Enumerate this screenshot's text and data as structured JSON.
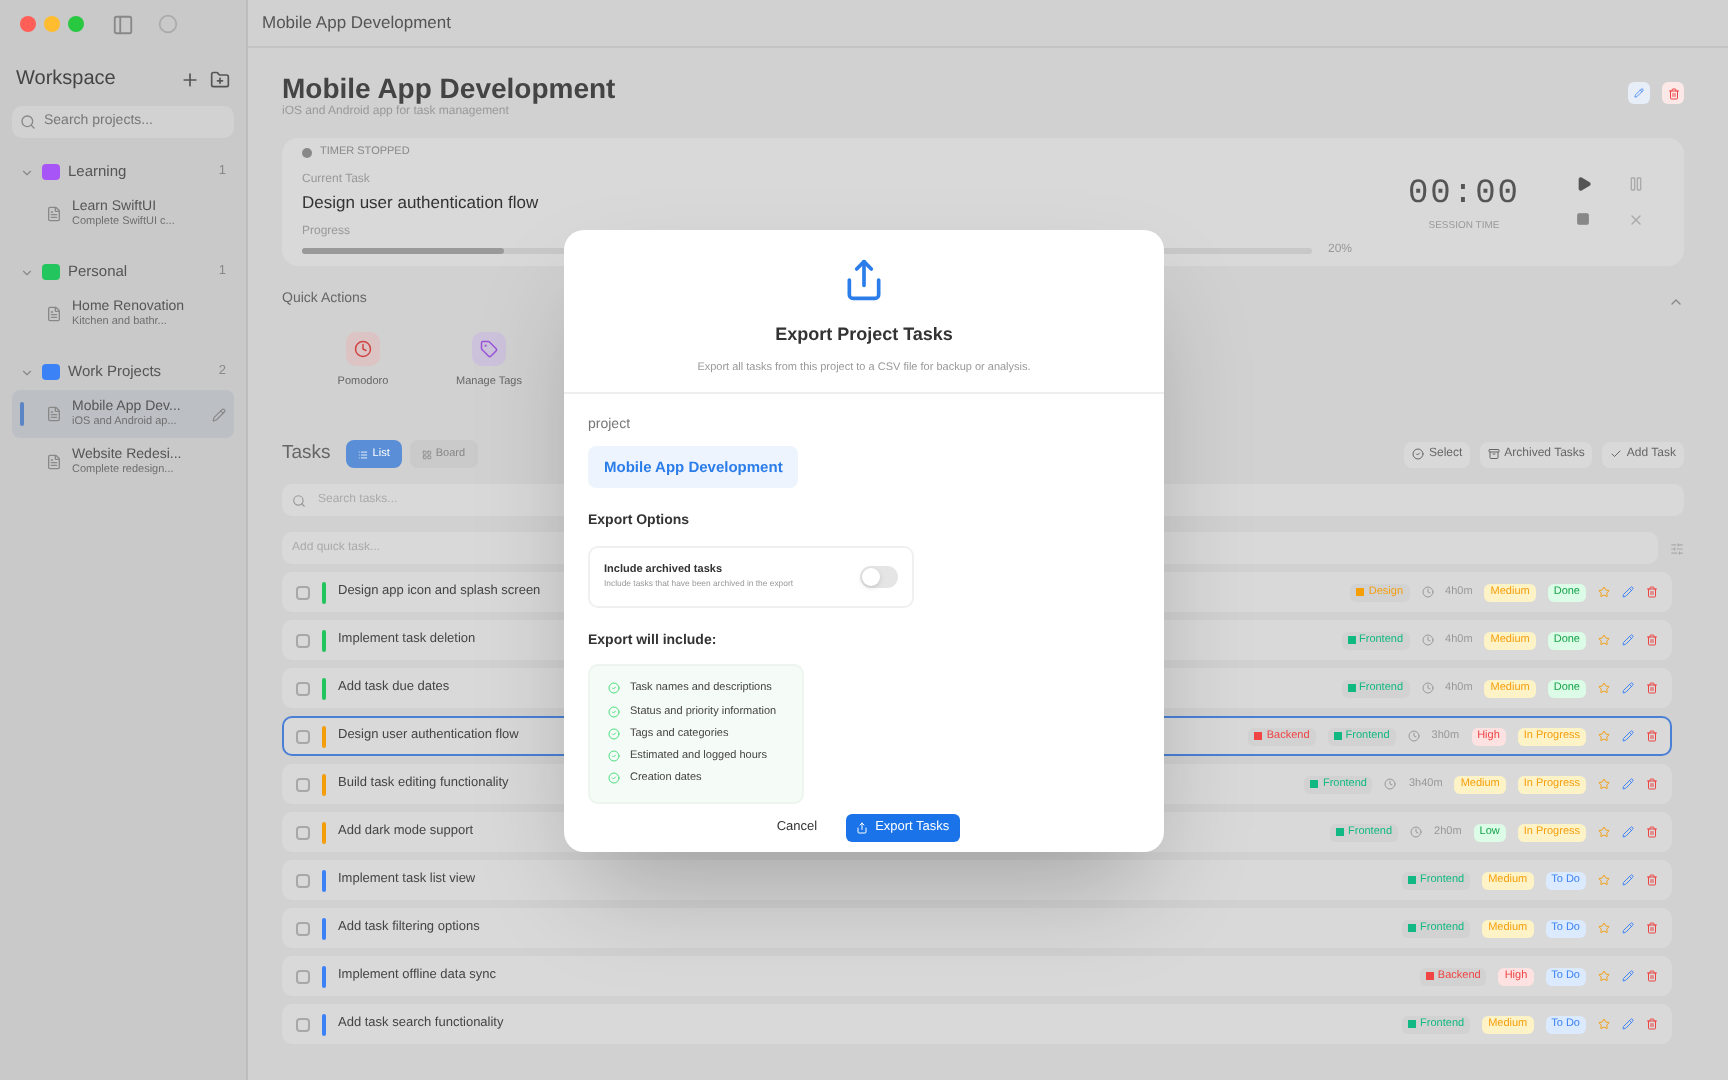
{
  "window": {
    "title": "Mobile App Development"
  },
  "sidebar": {
    "title": "Workspace",
    "search": {
      "placeholder": "Search projects..."
    },
    "groups": [
      {
        "name": "Learning",
        "color": "#a855f7",
        "count": "1",
        "projects": [
          {
            "name": "Learn SwiftUI",
            "description": "Complete SwiftUI c...",
            "selected": false
          }
        ]
      },
      {
        "name": "Personal",
        "color": "#22c55e",
        "count": "1",
        "projects": [
          {
            "name": "Home Renovation",
            "description": "Kitchen and bathr...",
            "selected": false
          }
        ]
      },
      {
        "name": "Work Projects",
        "color": "#3b82f6",
        "count": "2",
        "projects": [
          {
            "name": "Mobile App Dev...",
            "description": "iOS and Android ap...",
            "selected": true
          },
          {
            "name": "Website Redesi...",
            "description": "Complete redesign...",
            "selected": false
          }
        ]
      }
    ]
  },
  "project": {
    "title": "Mobile App Development",
    "subtitle": "iOS and Android app for task management"
  },
  "timer": {
    "status": "TIMER STOPPED",
    "current_label": "Current Task",
    "current_task": "Design user authentication flow",
    "progress_label": "Progress",
    "level": 0.2,
    "percent": "20%",
    "time": "00:00",
    "time_label": "SESSION TIME"
  },
  "quick_actions": {
    "title": "Quick Actions",
    "items": [
      {
        "kind": "pomodoro",
        "label": "Pomodoro"
      },
      {
        "kind": "tags",
        "label": "Manage Tags"
      }
    ]
  },
  "tasks": {
    "title": "Tasks",
    "views": [
      {
        "label": "List",
        "selected": true
      },
      {
        "label": "Board",
        "selected": false
      }
    ],
    "actions": [
      "Select",
      "Archived Tasks",
      "Add Task"
    ],
    "search": {
      "placeholder": "Search tasks..."
    },
    "quick_add": {
      "placeholder": "Add quick task..."
    },
    "rows": [
      {
        "title": "Design app icon and splash screen",
        "selected": false,
        "tags": [
          {
            "label": "Design",
            "color": "#f59e0b"
          }
        ],
        "time": "4h0m",
        "priority": {
          "kind": "medium",
          "label": "Medium"
        },
        "status": {
          "kind": "done",
          "label": "Done"
        }
      },
      {
        "title": "Implement task deletion",
        "selected": false,
        "tags": [
          {
            "label": "Frontend",
            "color": "#10b981"
          }
        ],
        "time": "4h0m",
        "priority": {
          "kind": "medium",
          "label": "Medium"
        },
        "status": {
          "kind": "done",
          "label": "Done"
        }
      },
      {
        "title": "Add task due dates",
        "selected": false,
        "tags": [
          {
            "label": "Frontend",
            "color": "#10b981"
          }
        ],
        "time": "4h0m",
        "priority": {
          "kind": "medium",
          "label": "Medium"
        },
        "status": {
          "kind": "done",
          "label": "Done"
        }
      },
      {
        "title": "Design user authentication flow",
        "selected": true,
        "tags": [
          {
            "label": "Backend",
            "color": "#ef4444"
          },
          {
            "label": "Frontend",
            "color": "#10b981"
          }
        ],
        "time": "3h0m",
        "priority": {
          "kind": "high",
          "label": "High"
        },
        "status": {
          "kind": "progress",
          "label": "In Progress"
        }
      },
      {
        "title": "Build task editing functionality",
        "selected": false,
        "tags": [
          {
            "label": "Frontend",
            "color": "#10b981"
          }
        ],
        "time": "3h40m",
        "priority": {
          "kind": "medium",
          "label": "Medium"
        },
        "status": {
          "kind": "progress",
          "label": "In Progress"
        }
      },
      {
        "title": "Add dark mode support",
        "selected": false,
        "tags": [
          {
            "label": "Frontend",
            "color": "#10b981"
          }
        ],
        "time": "2h0m",
        "priority": {
          "kind": "low",
          "label": "Low"
        },
        "status": {
          "kind": "progress",
          "label": "In Progress"
        }
      },
      {
        "title": "Implement task list view",
        "selected": false,
        "tags": [
          {
            "label": "Frontend",
            "color": "#10b981"
          }
        ],
        "priority": {
          "kind": "medium",
          "label": "Medium"
        },
        "status": {
          "kind": "todo",
          "label": "To Do"
        }
      },
      {
        "title": "Add task filtering options",
        "selected": false,
        "tags": [
          {
            "label": "Frontend",
            "color": "#10b981"
          }
        ],
        "priority": {
          "kind": "medium",
          "label": "Medium"
        },
        "status": {
          "kind": "todo",
          "label": "To Do"
        }
      },
      {
        "title": "Implement offline data sync",
        "selected": false,
        "tags": [
          {
            "label": "Backend",
            "color": "#ef4444"
          }
        ],
        "priority": {
          "kind": "high",
          "label": "High"
        },
        "status": {
          "kind": "todo",
          "label": "To Do"
        }
      },
      {
        "title": "Add task search functionality",
        "selected": false,
        "tags": [
          {
            "label": "Frontend",
            "color": "#10b981"
          }
        ],
        "priority": {
          "kind": "medium",
          "label": "Medium"
        },
        "status": {
          "kind": "todo",
          "label": "To Do"
        }
      }
    ]
  },
  "dialog": {
    "title": "Export Project Tasks",
    "description": "Export all tasks from this project to a CSV file for backup or analysis.",
    "project_label": "project",
    "project_name": "Mobile App Development",
    "options_title": "Export Options",
    "option": {
      "label": "Include archived tasks",
      "description": "Include tasks that have been archived in the export",
      "on": false
    },
    "includes_title": "Export will include:",
    "includes": [
      "Task names and descriptions",
      "Status and priority information",
      "Tags and categories",
      "Estimated and logged hours",
      "Creation dates"
    ],
    "buttons": [
      {
        "kind": "secondary",
        "label": "Cancel"
      },
      {
        "kind": "primary",
        "label": "Export Tasks"
      }
    ]
  }
}
